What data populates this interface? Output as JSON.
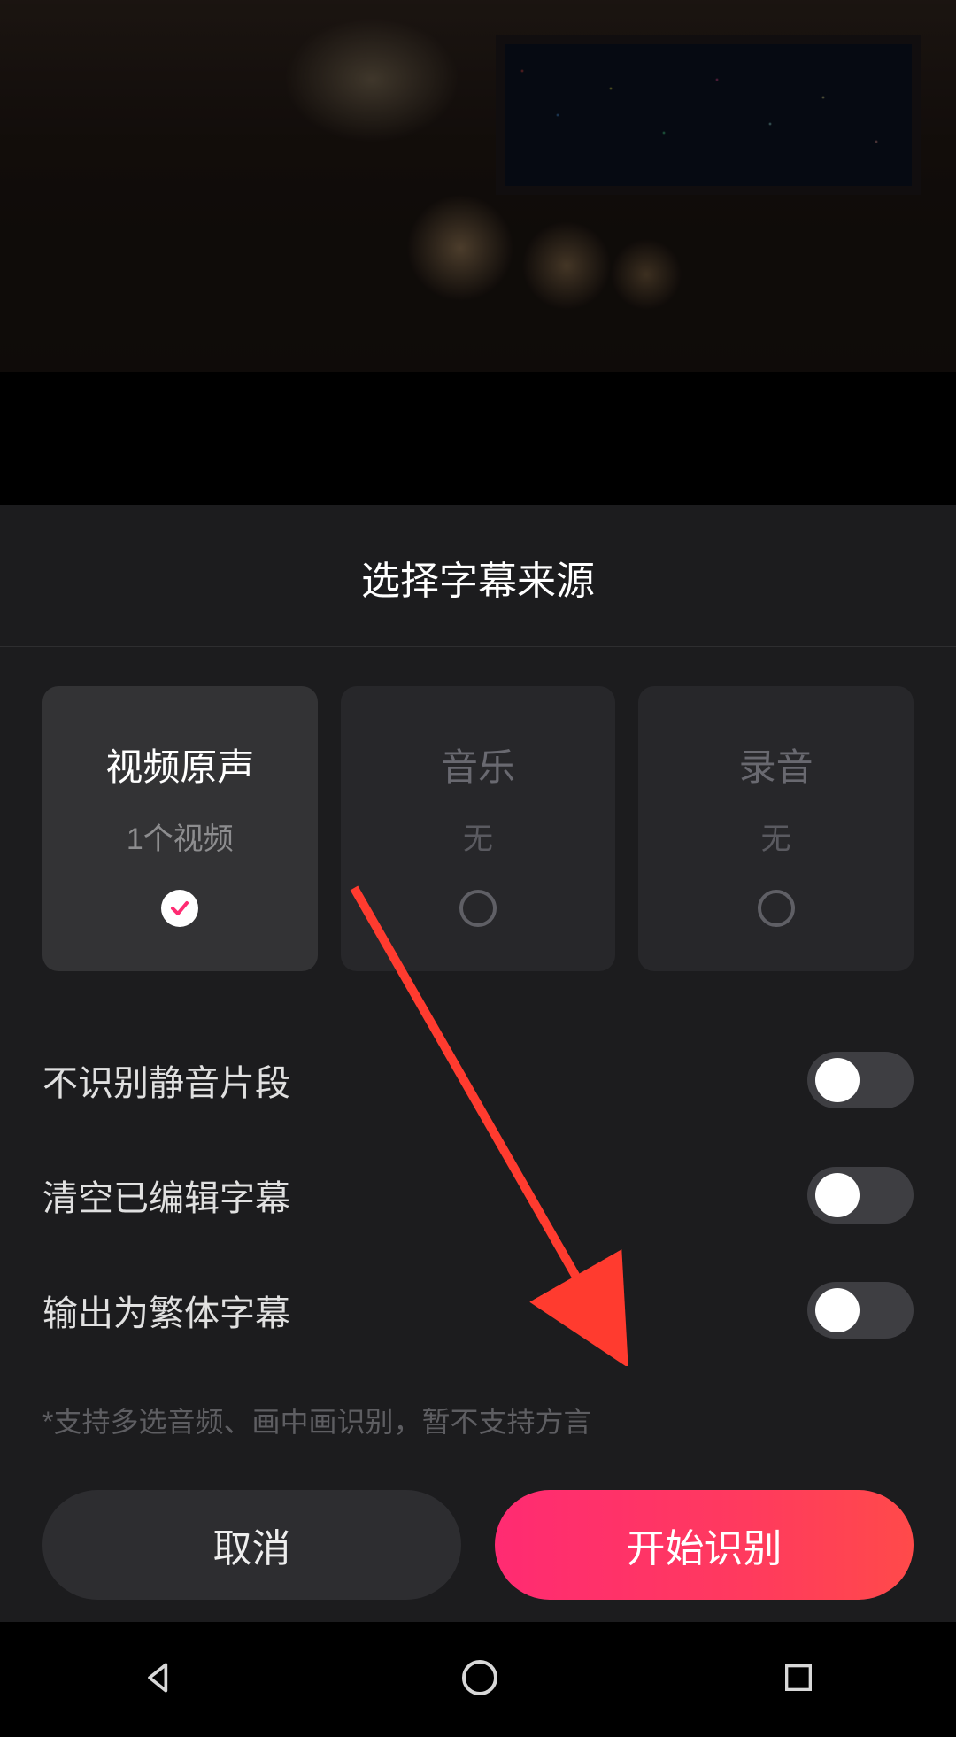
{
  "panel": {
    "title": "选择字幕来源",
    "sources": [
      {
        "title": "视频原声",
        "subtitle": "1个视频",
        "selected": true
      },
      {
        "title": "音乐",
        "subtitle": "无",
        "selected": false
      },
      {
        "title": "录音",
        "subtitle": "无",
        "selected": false
      }
    ],
    "options": [
      {
        "label": "不识别静音片段",
        "value": false
      },
      {
        "label": "清空已编辑字幕",
        "value": false
      },
      {
        "label": "输出为繁体字幕",
        "value": false
      }
    ],
    "hint": "*支持多选音频、画中画识别，暂不支持方言",
    "cancel_label": "取消",
    "confirm_label": "开始识别"
  },
  "colors": {
    "accent_start": "#ff2b72",
    "accent_end": "#ff4a4a"
  }
}
